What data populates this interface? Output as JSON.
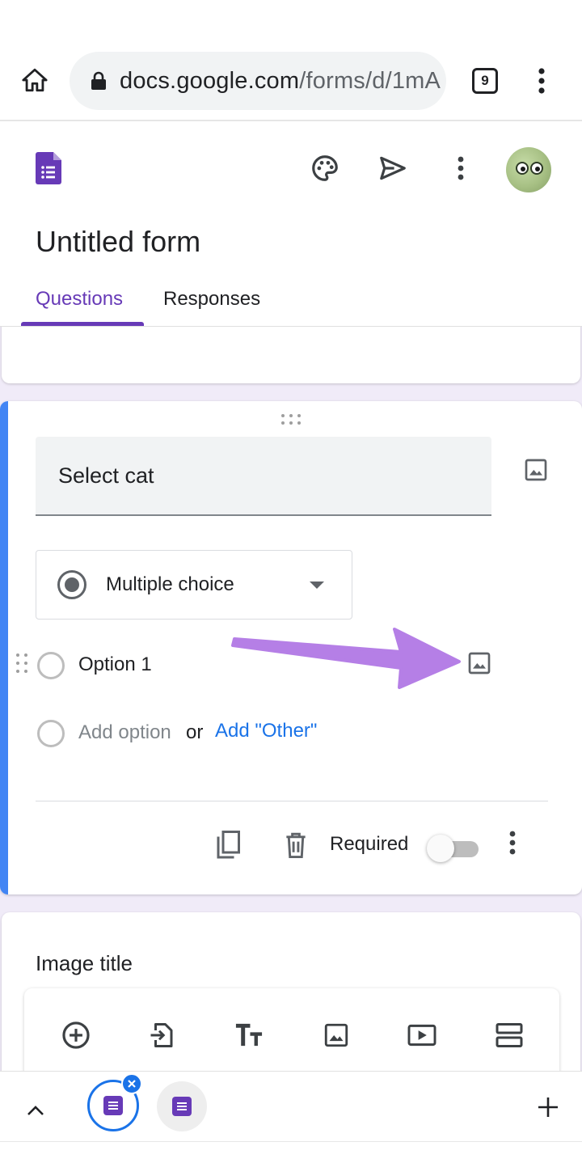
{
  "browser": {
    "url_host": "docs.google.com",
    "url_path": "/forms/d/1mA",
    "tab_count": "9",
    "icons": [
      "home-icon",
      "lock-icon",
      "tab-switcher-icon",
      "more-vert-icon"
    ]
  },
  "header": {
    "title": "Untitled form",
    "icons": [
      "forms-logo-icon",
      "palette-icon",
      "send-icon",
      "more-vert-icon",
      "avatar"
    ]
  },
  "tabs": [
    {
      "label": "Questions",
      "active": true
    },
    {
      "label": "Responses",
      "active": false
    }
  ],
  "question": {
    "title": "Select cat",
    "type_label": "Multiple choice",
    "options": [
      {
        "label": "Option 1"
      }
    ],
    "add_option": "Add option",
    "or_text": "or",
    "add_other": "Add \"Other\"",
    "required_label": "Required",
    "required_on": false
  },
  "image_block": {
    "title": "Image title",
    "tools": [
      "add-question-icon",
      "import-questions-icon",
      "add-title-icon",
      "add-image-icon",
      "add-video-icon",
      "add-section-icon"
    ]
  },
  "colors": {
    "accent_purple": "#673ab7",
    "accent_blue": "#4285f4",
    "link_blue": "#1a73e8",
    "annotation_arrow": "#b57fe6",
    "background": "#f0ebf8"
  }
}
